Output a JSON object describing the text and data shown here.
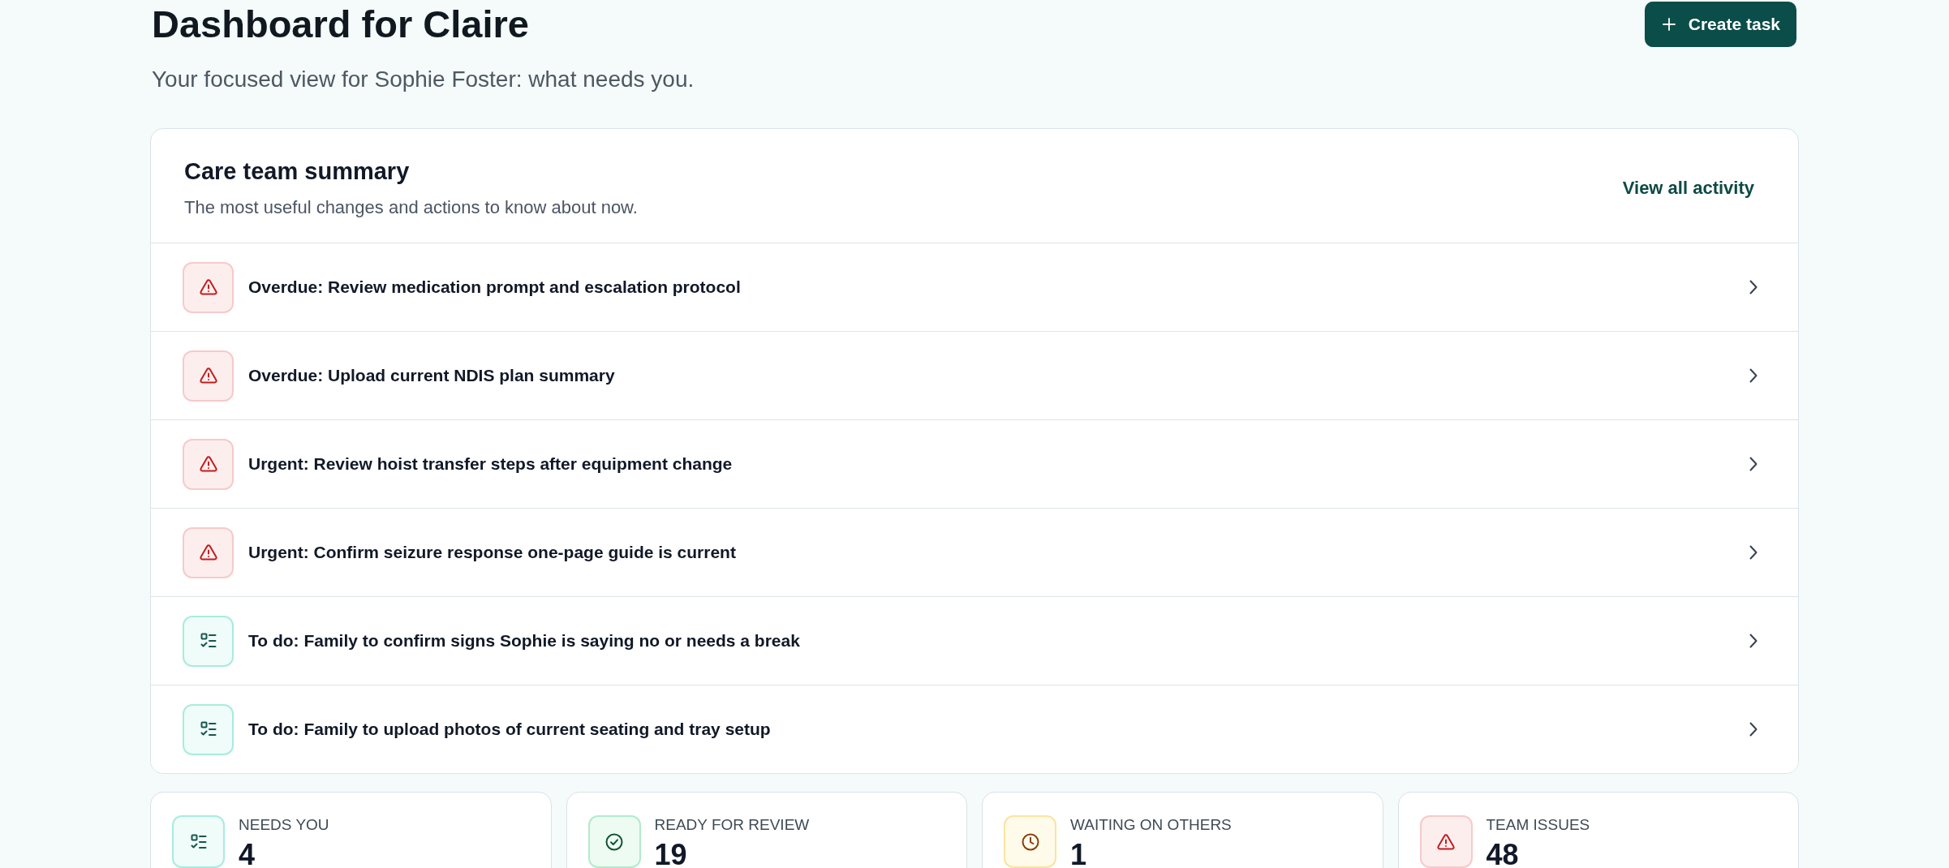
{
  "header": {
    "title": "Dashboard for Claire",
    "subtitle": "Your focused view for Sophie Foster: what needs you.",
    "create_button": "Create task"
  },
  "summary": {
    "title": "Care team summary",
    "subtitle": "The most useful changes and actions to know about now.",
    "link": "View all activity",
    "items": [
      {
        "kind": "alert",
        "label": "Overdue: Review medication prompt and escalation protocol"
      },
      {
        "kind": "alert",
        "label": "Overdue: Upload current NDIS plan summary"
      },
      {
        "kind": "alert",
        "label": "Urgent: Review hoist transfer steps after equipment change"
      },
      {
        "kind": "alert",
        "label": "Urgent: Confirm seizure response one-page guide is current"
      },
      {
        "kind": "todo",
        "label": "To do: Family to confirm signs Sophie is saying no or needs a break"
      },
      {
        "kind": "todo",
        "label": "To do: Family to upload photos of current seating and tray setup"
      }
    ]
  },
  "stats": [
    {
      "kind": "todo",
      "label": "NEEDS YOU",
      "value": "4"
    },
    {
      "kind": "review",
      "label": "READY FOR REVIEW",
      "value": "19"
    },
    {
      "kind": "waiting",
      "label": "WAITING ON OTHERS",
      "value": "1"
    },
    {
      "kind": "issue",
      "label": "TEAM ISSUES",
      "value": "48"
    }
  ]
}
